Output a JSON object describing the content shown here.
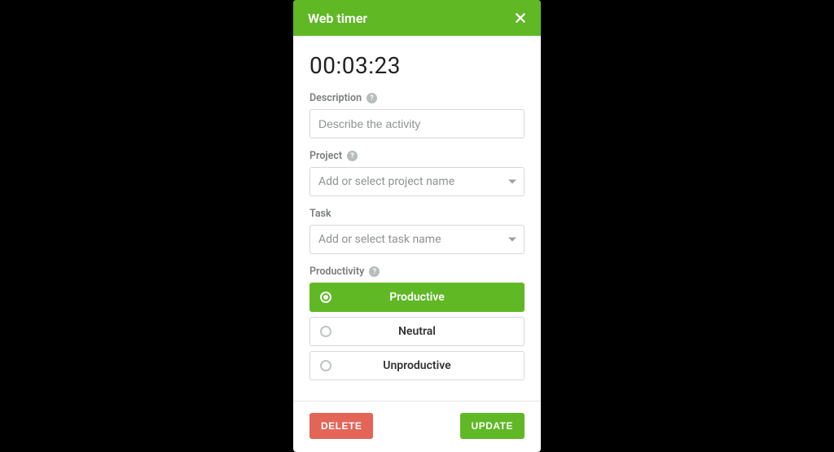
{
  "header": {
    "title": "Web timer"
  },
  "timer": {
    "value": "00:03:23"
  },
  "description": {
    "label": "Description",
    "placeholder": "Describe the activity",
    "value": ""
  },
  "project": {
    "label": "Project",
    "placeholder": "Add or select project name"
  },
  "task": {
    "label": "Task",
    "placeholder": "Add or select task name"
  },
  "productivity": {
    "label": "Productivity",
    "options": [
      {
        "key": "productive",
        "label": "Productive",
        "selected": true
      },
      {
        "key": "neutral",
        "label": "Neutral",
        "selected": false
      },
      {
        "key": "unproductive",
        "label": "Unproductive",
        "selected": false
      }
    ]
  },
  "buttons": {
    "delete": "DELETE",
    "update": "UPDATE"
  },
  "colors": {
    "accent": "#5fb824",
    "danger": "#e26558"
  }
}
